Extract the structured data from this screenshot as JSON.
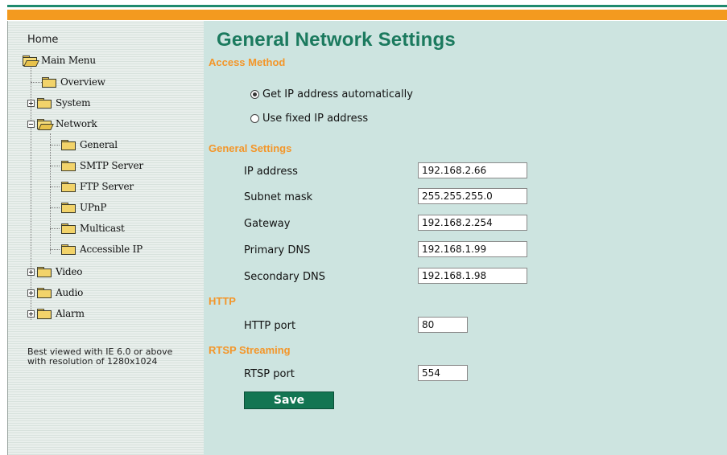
{
  "colors": {
    "accent_green": "#1b7a5e",
    "accent_orange": "#f39a1f",
    "panel_background": "#cde4e0",
    "button_background": "#137552"
  },
  "sidebar": {
    "home": "Home",
    "main_menu": "Main Menu",
    "overview": "Overview",
    "system": "System",
    "network": "Network",
    "network_children": {
      "general": "General",
      "smtp": "SMTP Server",
      "ftp": "FTP Server",
      "upnp": "UPnP",
      "multicast": "Multicast",
      "accessible_ip": "Accessible IP"
    },
    "video": "Video",
    "audio": "Audio",
    "alarm": "Alarm",
    "note": "Best viewed with IE 6.0 or above with resolution of 1280x1024"
  },
  "main": {
    "title": "General Network Settings",
    "access_method": {
      "heading": "Access Method",
      "option_auto": "Get IP address automatically",
      "option_fixed": "Use fixed IP address",
      "selected": "auto"
    },
    "general_settings": {
      "heading": "General Settings",
      "ip_label": "IP address",
      "ip_value": "192.168.2.66",
      "subnet_label": "Subnet mask",
      "subnet_value": "255.255.255.0",
      "gateway_label": "Gateway",
      "gateway_value": "192.168.2.254",
      "primary_dns_label": "Primary DNS",
      "primary_dns_value": "192.168.1.99",
      "secondary_dns_label": "Secondary DNS",
      "secondary_dns_value": "192.168.1.98"
    },
    "http": {
      "heading": "HTTP",
      "port_label": "HTTP port",
      "port_value": "80"
    },
    "rtsp": {
      "heading": "RTSP Streaming",
      "port_label": "RTSP port",
      "port_value": "554"
    },
    "save_label": "Save"
  }
}
